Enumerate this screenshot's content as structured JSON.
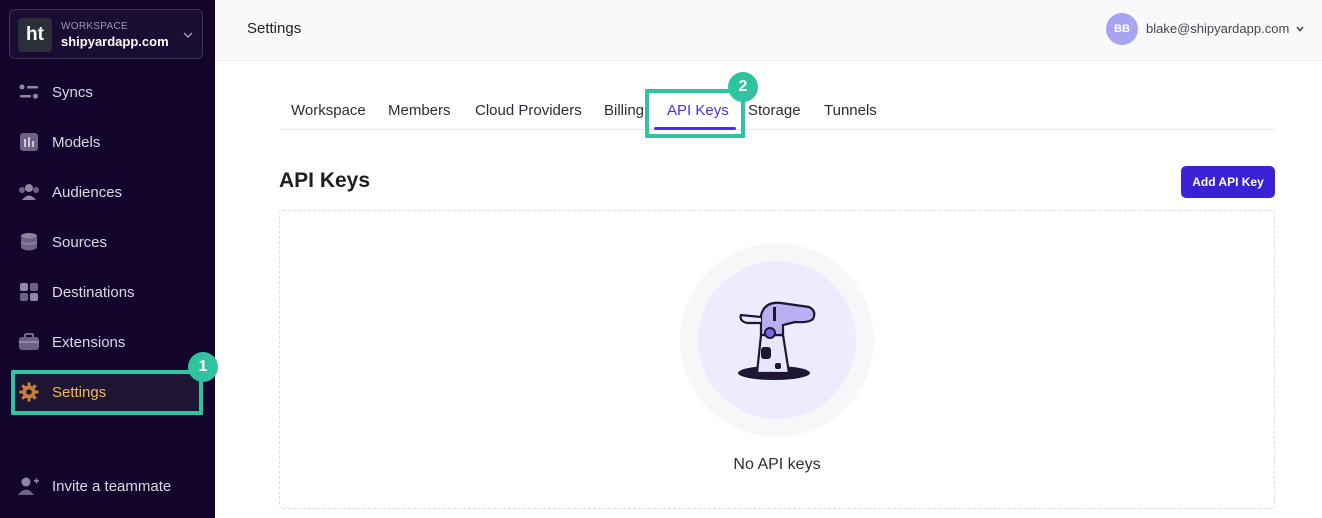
{
  "workspace": {
    "label": "WORKSPACE",
    "name": "shipyardapp.com",
    "logo_text": "ht"
  },
  "sidebar": {
    "items": [
      {
        "label": "Syncs",
        "icon": "syncs-icon"
      },
      {
        "label": "Models",
        "icon": "models-icon"
      },
      {
        "label": "Audiences",
        "icon": "audiences-icon"
      },
      {
        "label": "Sources",
        "icon": "database-icon"
      },
      {
        "label": "Destinations",
        "icon": "grid-icon"
      },
      {
        "label": "Extensions",
        "icon": "briefcase-icon"
      },
      {
        "label": "Settings",
        "icon": "gear-icon",
        "active": true
      }
    ],
    "invite_label": "Invite a teammate"
  },
  "annotations": {
    "step1": "1",
    "step2": "2",
    "highlight_color": "#2fc3a0"
  },
  "header": {
    "title": "Settings",
    "avatar_initials": "BB",
    "user_email": "blake@shipyardapp.com"
  },
  "tabs": [
    {
      "label": "Workspace"
    },
    {
      "label": "Members"
    },
    {
      "label": "Cloud Providers"
    },
    {
      "label": "Billing"
    },
    {
      "label": "API Keys",
      "active": true
    },
    {
      "label": "Storage"
    },
    {
      "label": "Tunnels"
    }
  ],
  "main": {
    "title": "API Keys",
    "add_button_label": "Add API Key",
    "empty_message": "No API keys"
  },
  "colors": {
    "sidebar_bg": "#13052b",
    "accent": "#3b21d6",
    "active_label": "#f2b84b",
    "tab_active": "#4a2ef0"
  }
}
